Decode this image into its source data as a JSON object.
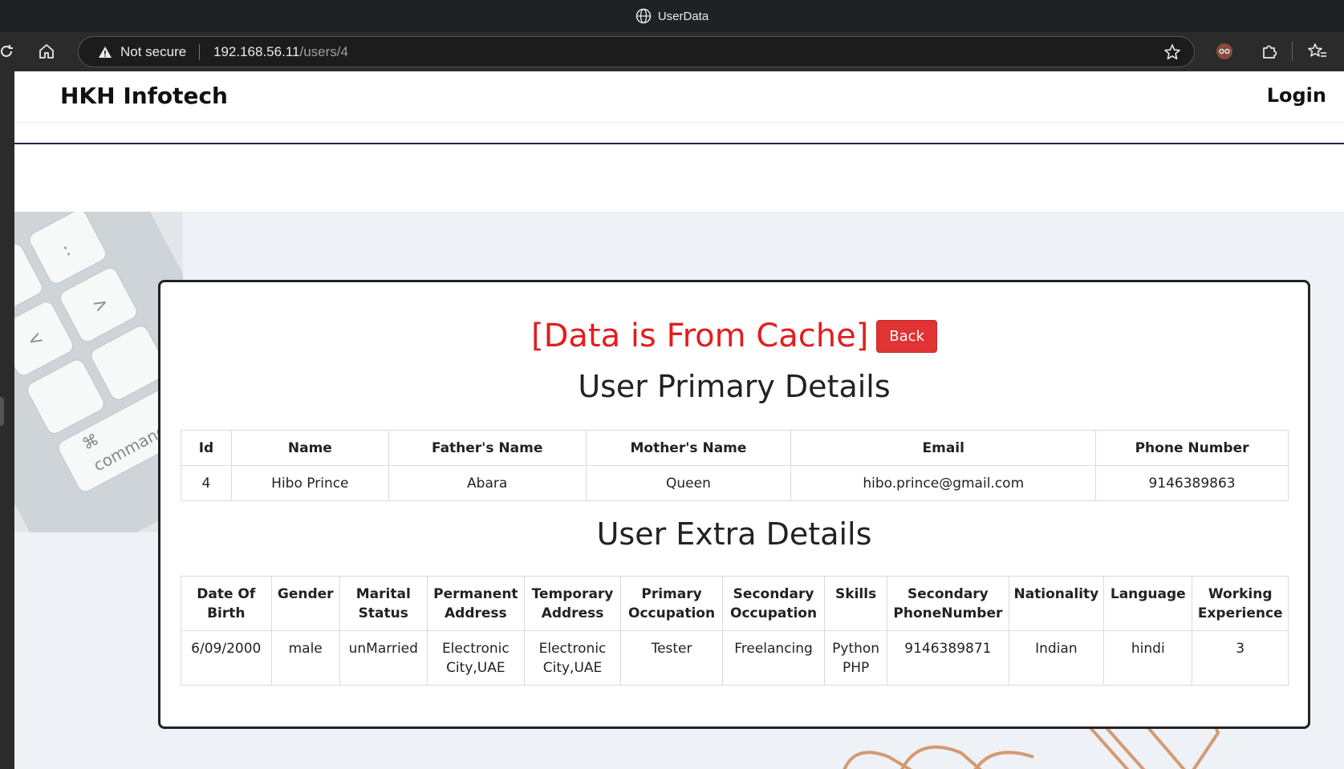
{
  "browser": {
    "window_title": "UserData",
    "security_label": "Not secure",
    "url_host": "192.168.56.11",
    "url_path": "/users/4"
  },
  "navbar": {
    "brand": "HKH Infotech",
    "login_label": "Login"
  },
  "notice": {
    "cache_text": "[Data is From Cache]",
    "back_label": "Back"
  },
  "primary": {
    "heading": "User Primary Details",
    "headers": [
      "Id",
      "Name",
      "Father's Name",
      "Mother's Name",
      "Email",
      "Phone Number"
    ],
    "row": [
      "4",
      "Hibo Prince",
      "Abara",
      "Queen",
      "hibo.prince@gmail.com",
      "9146389863"
    ]
  },
  "extra": {
    "heading": "User Extra Details",
    "headers": [
      "Date Of Birth",
      "Gender",
      "Marital Status",
      "Permanent Address",
      "Temporary Address",
      "Primary Occupation",
      "Secondary Occupation",
      "Skills",
      "Secondary PhoneNumber",
      "Nationality",
      "Language",
      "Working Experience"
    ],
    "row": [
      "6/09/2000",
      "male",
      "unMarried",
      "Electronic City,UAE",
      "Electronic City,UAE",
      "Tester",
      "Freelancing",
      "Python PHP",
      "9146389871",
      "Indian",
      "hindi",
      "3"
    ]
  },
  "colors": {
    "cache_red": "#e41d1d",
    "back_button": "#e13333",
    "nav_line": "#1f2a44"
  }
}
